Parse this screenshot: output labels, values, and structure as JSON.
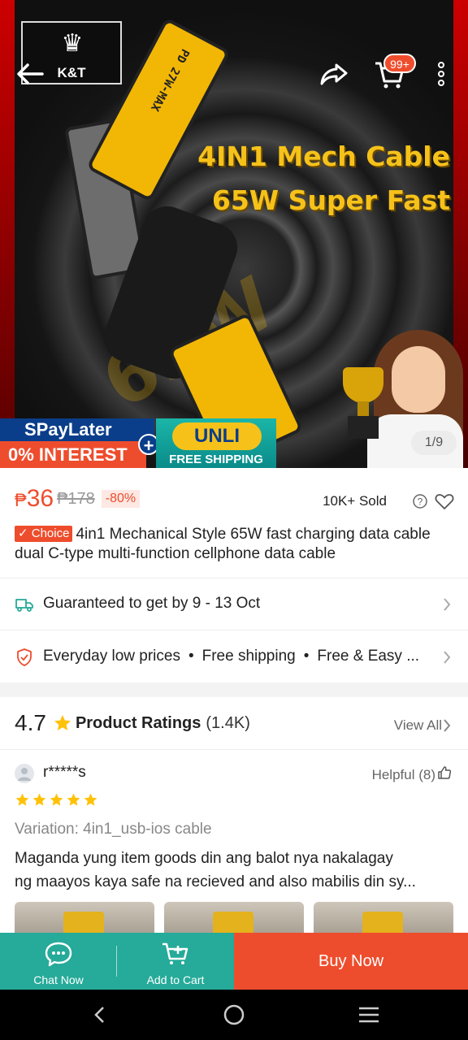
{
  "hero": {
    "headline_line1": "4IN1 Mech Cable",
    "headline_line2": "65W Super Fast",
    "cable_label": "PD 27W-MAX",
    "watermark": "65W",
    "logo_text": "K&T",
    "cart_badge": "99+",
    "spaylater_brand": "SPayLater",
    "spaylater_offer": "0% INTEREST",
    "unli_title": "UNLI",
    "unli_sub": "FREE SHIPPING",
    "page_indicator": "1/9",
    "accent_color": "#f6c21a"
  },
  "product": {
    "currency": "₱",
    "price": "36",
    "old_price": "₱178",
    "discount": "-80%",
    "sold": "10K+ Sold",
    "choice_badge": "✓ Choice",
    "title": "4in1 Mechanical Style 65W fast charging data cable dual C-type multi-function cellphone data cable"
  },
  "delivery": {
    "text": "Guaranteed to get by 9 - 13 Oct"
  },
  "benefits": {
    "items": [
      "Everyday low prices",
      "Free shipping",
      "Free & Easy ..."
    ]
  },
  "ratings": {
    "score": "4.7",
    "title": "Product Ratings",
    "count": "(1.4K)",
    "view_all": "View All"
  },
  "review": {
    "user": "r*****s",
    "helpful": "Helpful (8)",
    "stars": 5,
    "variation": "Variation: 4in1_usb-ios cable",
    "line1": "Maganda yung item goods din ang balot nya nakalagay",
    "line2": "ng maayos kaya safe na recieved and also mabilis din sy..."
  },
  "bottom_bar": {
    "chat": "Chat Now",
    "add_to_cart": "Add to Cart",
    "buy_now": "Buy Now"
  },
  "colors": {
    "brand": "#ee4d2d",
    "teal": "#26aa99",
    "star": "#ffc107"
  }
}
